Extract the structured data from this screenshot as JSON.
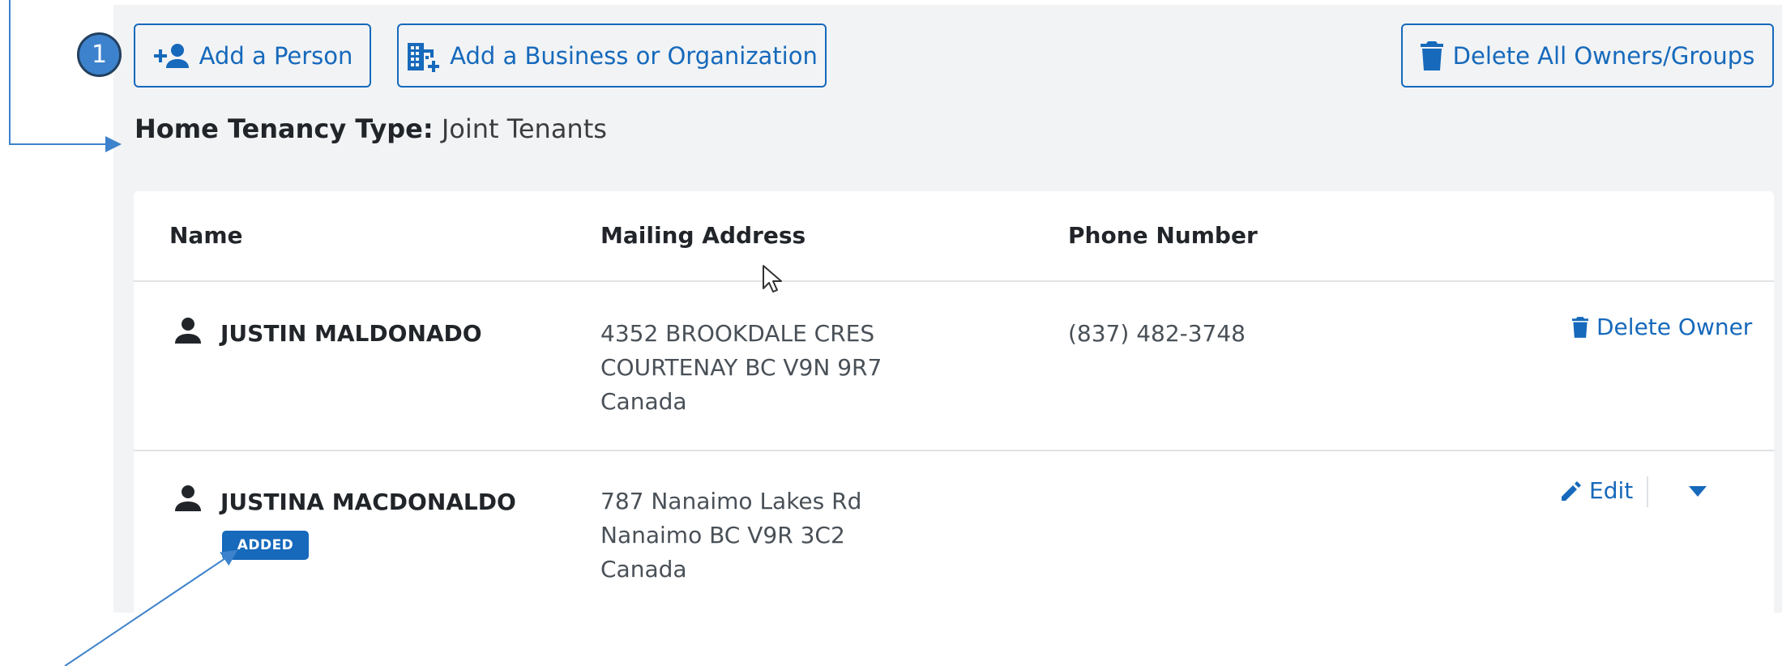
{
  "toolbar": {
    "callout_number": "1",
    "add_person_label": "Add a Person",
    "add_business_label": "Add a Business or Organization",
    "delete_all_label": "Delete All Owners/Groups"
  },
  "tenancy": {
    "label": "Home Tenancy Type:",
    "value": "Joint Tenants"
  },
  "table": {
    "headers": [
      "Name",
      "Mailing Address",
      "Phone Number"
    ],
    "rows": [
      {
        "name": "JUSTIN MALDONADO",
        "address": [
          "4352 BROOKDALE CRES",
          "COURTENAY BC  V9N 9R7",
          "Canada"
        ],
        "phone": "(837) 482-3748",
        "action_label": "Delete Owner"
      },
      {
        "name": "JUSTINA MACDONALDO",
        "badge": "ADDED",
        "address": [
          "787 Nanaimo Lakes Rd",
          "Nanaimo BC  V9R 3C2",
          "Canada"
        ],
        "phone": "",
        "action_label": "Edit"
      }
    ]
  },
  "colors": {
    "accent": "#1669bb",
    "panel_bg": "#f1f3f5",
    "callout_fill": "#3d82cc",
    "annotation_line": "#3d82cc"
  },
  "icons": [
    "person-add-icon",
    "business-add-icon",
    "trash-icon",
    "person-icon",
    "pencil-icon",
    "caret-down-icon",
    "mouse-cursor-icon"
  ]
}
